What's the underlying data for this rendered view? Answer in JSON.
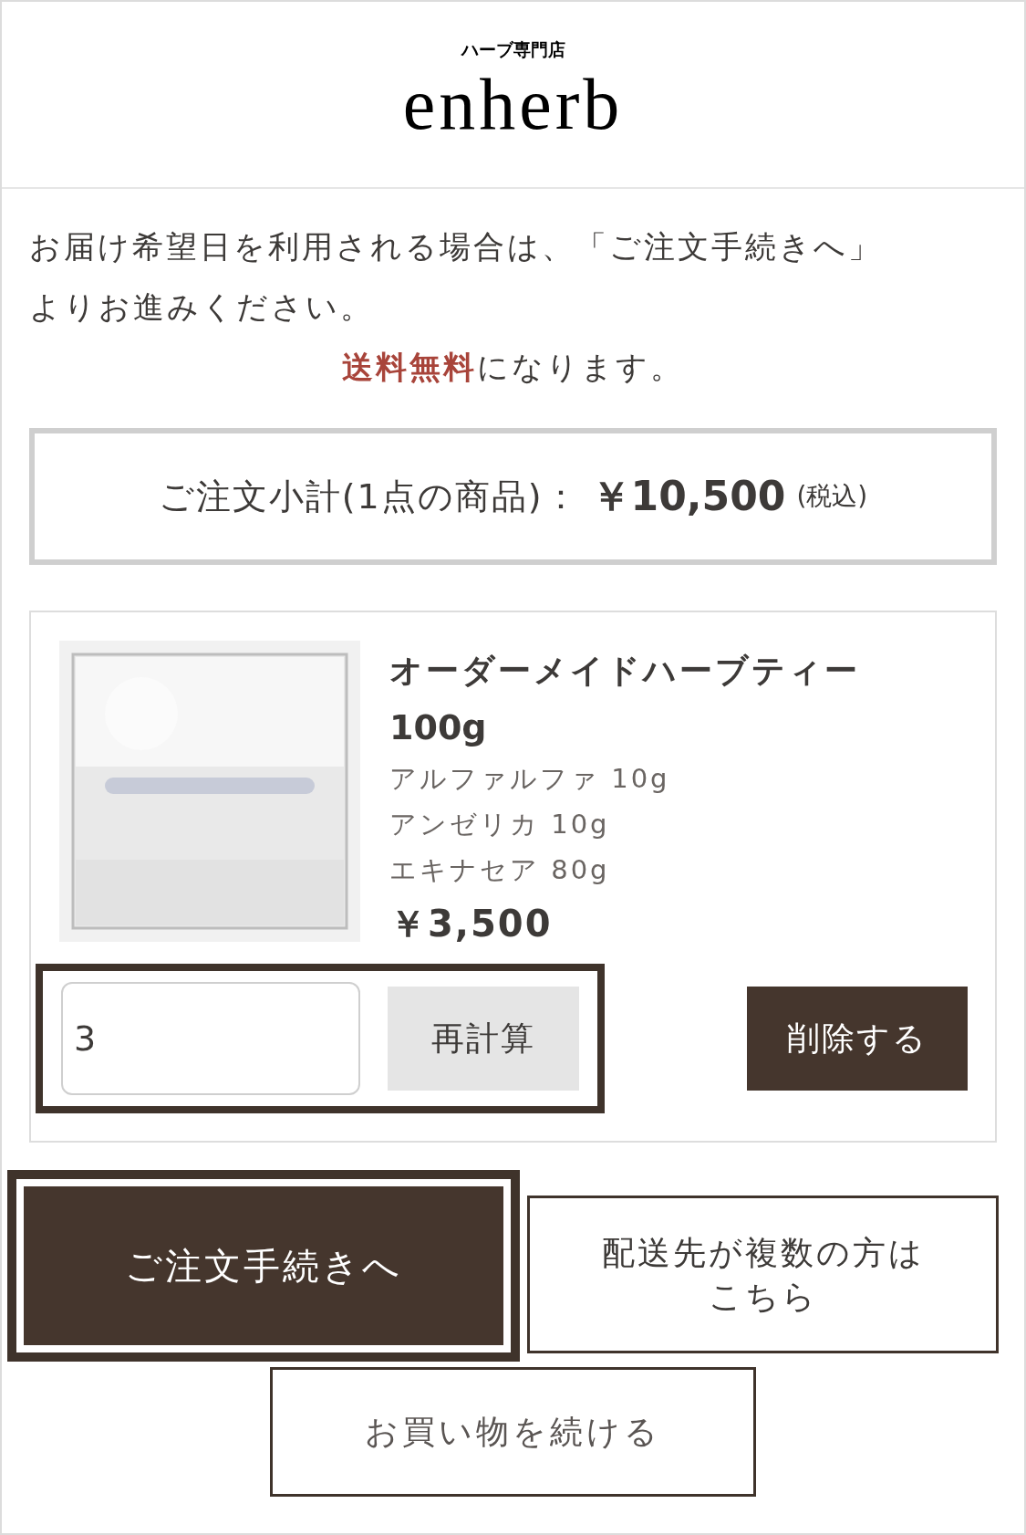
{
  "header": {
    "tagline": "ハーブ専門店",
    "logo": "enherb"
  },
  "notice": {
    "lines": [
      "お届け希望日を利用される場合は、「ご注文手続きへ」",
      "よりお進みください。"
    ],
    "shipping": "**送料無料**になります。"
  },
  "subtotal": {
    "label": "ご注文小計(1点の商品)：",
    "amount": "￥10,500",
    "tax": "(税込)"
  },
  "cart_items": [
    {
      "name": "オーダーメイドハーブティー",
      "size": "100g",
      "options": [
        "アルファルファ 10g",
        "アンゼリカ 10g",
        "エキナセア 80g"
      ],
      "price": "￥3,500",
      "quantity": "3",
      "recalc": "再計算",
      "delete": "削除する"
    }
  ],
  "actions": {
    "checkout": "ご注文手続きへ",
    "multi_address": [
      "配送先が複数の方は",
      "こちら"
    ],
    "continue": "お買い物を続ける"
  }
}
